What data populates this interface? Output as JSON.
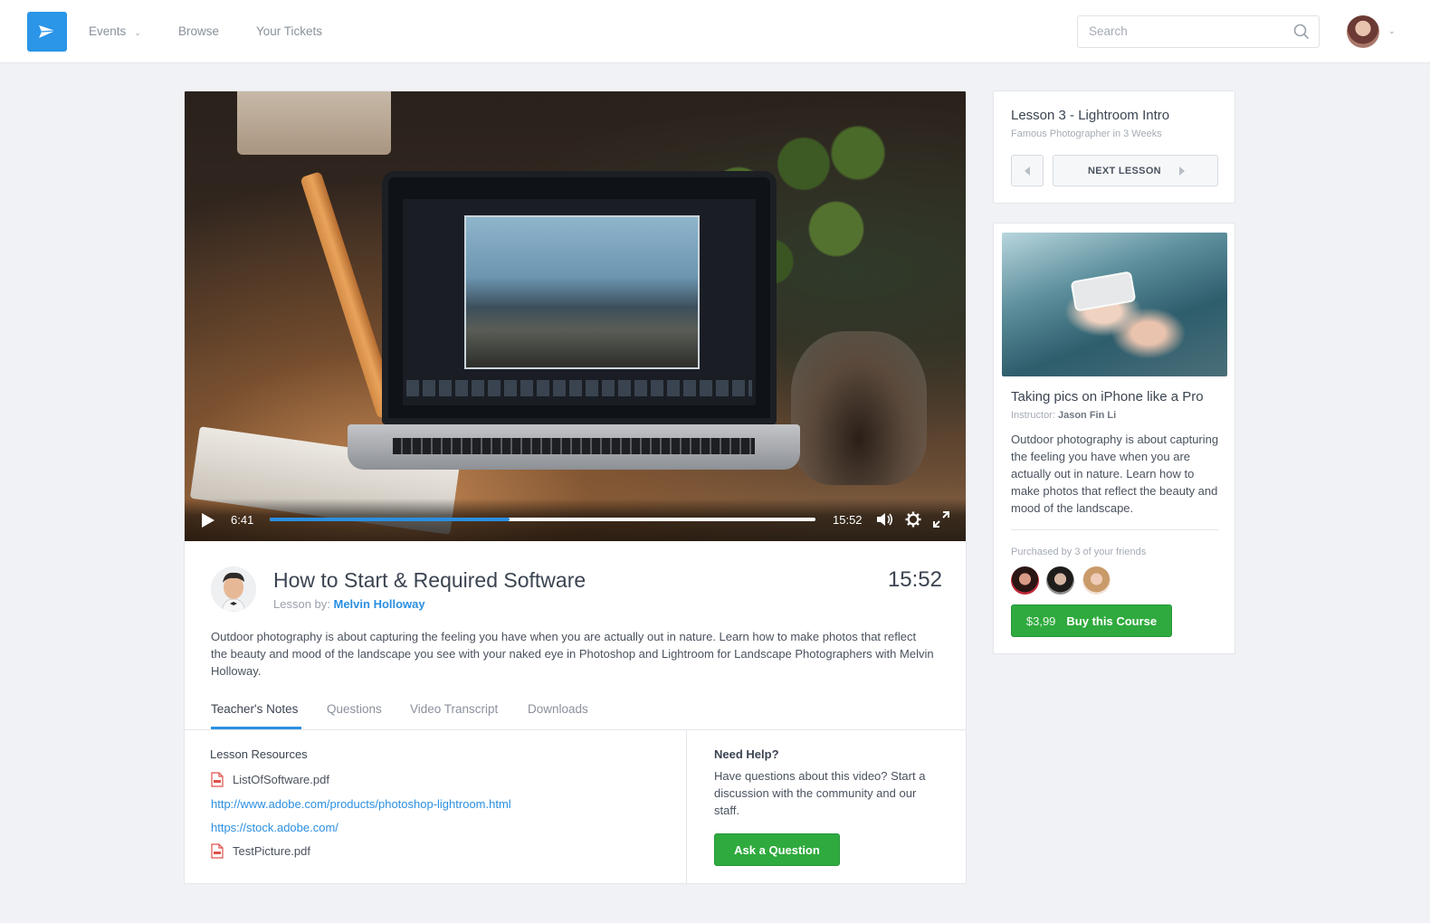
{
  "nav": {
    "items": [
      {
        "label": "Events",
        "has_dropdown": true
      },
      {
        "label": "Browse"
      },
      {
        "label": "Your Tickets"
      }
    ],
    "search_placeholder": "Search"
  },
  "video": {
    "current_time": "6:41",
    "total_time": "15:52",
    "progress_fraction": 0.44
  },
  "lesson": {
    "title": "How to Start & Required Software",
    "by_label": "Lesson by:",
    "teacher": "Melvin Holloway",
    "duration": "15:52",
    "description": "Outdoor photography is about capturing the feeling you have when you are actually out in nature. Learn how to make photos that reflect the beauty and mood of the landscape you see with your naked eye in Photoshop and Lightroom for Landscape Photographers with Melvin Holloway."
  },
  "tabs": [
    {
      "label": "Teacher's Notes",
      "active": true
    },
    {
      "label": "Questions"
    },
    {
      "label": "Video Transcript"
    },
    {
      "label": "Downloads"
    }
  ],
  "resources": {
    "title": "Lesson Resources",
    "items": [
      {
        "type": "pdf",
        "text": "ListOfSoftware.pdf"
      },
      {
        "type": "link",
        "text": "http://www.adobe.com/products/photoshop-lightroom.html"
      },
      {
        "type": "link",
        "text": "https://stock.adobe.com/"
      },
      {
        "type": "pdf",
        "text": "TestPicture.pdf"
      }
    ]
  },
  "help": {
    "title": "Need Help?",
    "text": "Have questions about this video? Start a discussion with the community and our staff.",
    "button": "Ask a Question"
  },
  "next_lesson": {
    "title": "Lesson 3 - Lightroom Intro",
    "subtitle": "Famous Photographer in 3 Weeks",
    "button": "NEXT LESSON"
  },
  "course": {
    "title": "Taking pics on iPhone like a Pro",
    "instructor_label": "Instructor:",
    "instructor": "Jason Fin Li",
    "description": "Outdoor photography is about capturing the feeling you have when you are actually out in nature. Learn how to make photos that reflect the beauty and mood of the landscape.",
    "friends_label": "Purchased by 3 of your friends",
    "price": "$3,99",
    "buy_label": "Buy this Course"
  },
  "colors": {
    "accent": "#2b8fe0",
    "green": "#2faa3e",
    "logo": "#2b95e8"
  }
}
